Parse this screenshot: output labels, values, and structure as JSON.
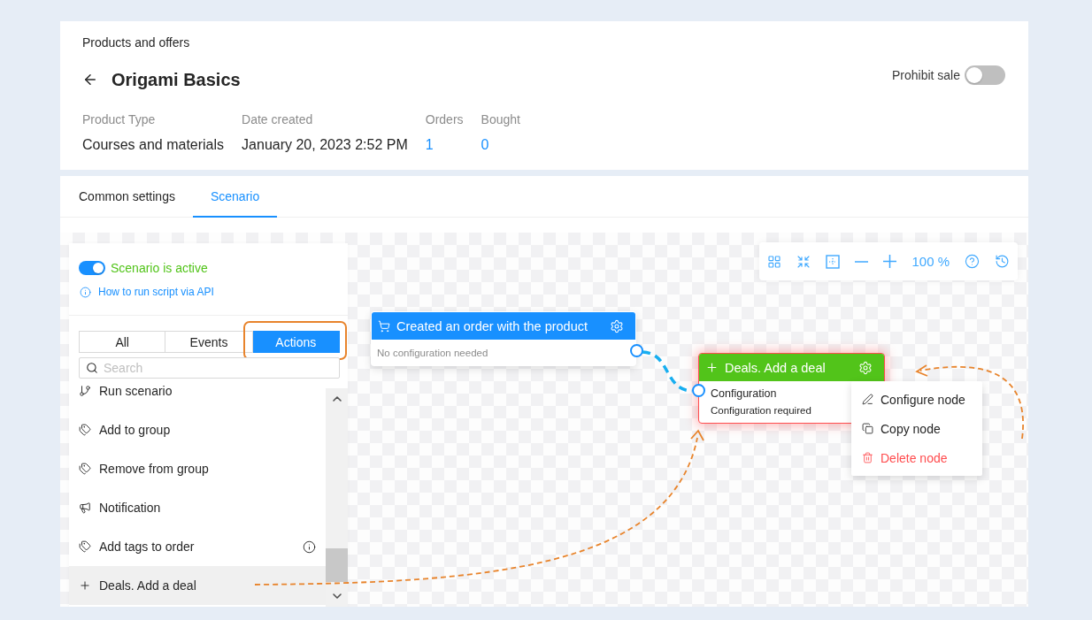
{
  "breadcrumb": "Products and offers",
  "product": {
    "title": "Origami Basics",
    "prohibit_sale": {
      "label": "Prohibit sale",
      "on": false
    }
  },
  "meta": [
    {
      "label": "Product Type",
      "value": "Courses and materials",
      "kind": "text"
    },
    {
      "label": "Date created",
      "value": "January 20, 2023 2:52 PM",
      "kind": "text"
    },
    {
      "label": "Orders",
      "value": "1",
      "kind": "link"
    },
    {
      "label": "Bought",
      "value": "0",
      "kind": "link"
    }
  ],
  "tabs": [
    {
      "label": "Common settings",
      "selected": false
    },
    {
      "label": "Scenario",
      "selected": true
    }
  ],
  "scenario_panel": {
    "status": {
      "label": "Scenario is active",
      "on": true
    },
    "api_link": "How to run script via API",
    "filters": [
      {
        "label": "All",
        "selected": false,
        "highlighted": false
      },
      {
        "label": "Events",
        "selected": false,
        "highlighted": false
      },
      {
        "label": "Actions",
        "selected": true,
        "highlighted": true
      }
    ],
    "search": {
      "placeholder": "Search"
    },
    "items": [
      {
        "label": "Run scenario",
        "kind": "run",
        "info": false,
        "selected": false
      },
      {
        "label": "Add to group",
        "kind": "tag",
        "info": false,
        "selected": false
      },
      {
        "label": "Remove from group",
        "kind": "tag",
        "info": false,
        "selected": false
      },
      {
        "label": "Notification",
        "kind": "notification",
        "info": false,
        "selected": false
      },
      {
        "label": "Add tags to order",
        "kind": "tag",
        "info": true,
        "selected": false
      },
      {
        "label": "Deals. Add a deal",
        "kind": "deal",
        "info": false,
        "selected": true
      }
    ]
  },
  "canvas": {
    "zoom": "100 %",
    "nodes": [
      {
        "kind": "trigger",
        "title": "Created an order with the product",
        "color": "#1890ff",
        "lines": [
          "No configuration needed"
        ],
        "error": false
      },
      {
        "kind": "action",
        "title": "Deals. Add a deal",
        "color": "#52c41a",
        "lines": [
          "Configuration",
          "Configuration required"
        ],
        "error": true
      }
    ],
    "context_menu": [
      {
        "label": "Configure node",
        "kind": "edit"
      },
      {
        "label": "Copy node",
        "kind": "copy"
      },
      {
        "label": "Delete node",
        "kind": "delete"
      }
    ]
  }
}
